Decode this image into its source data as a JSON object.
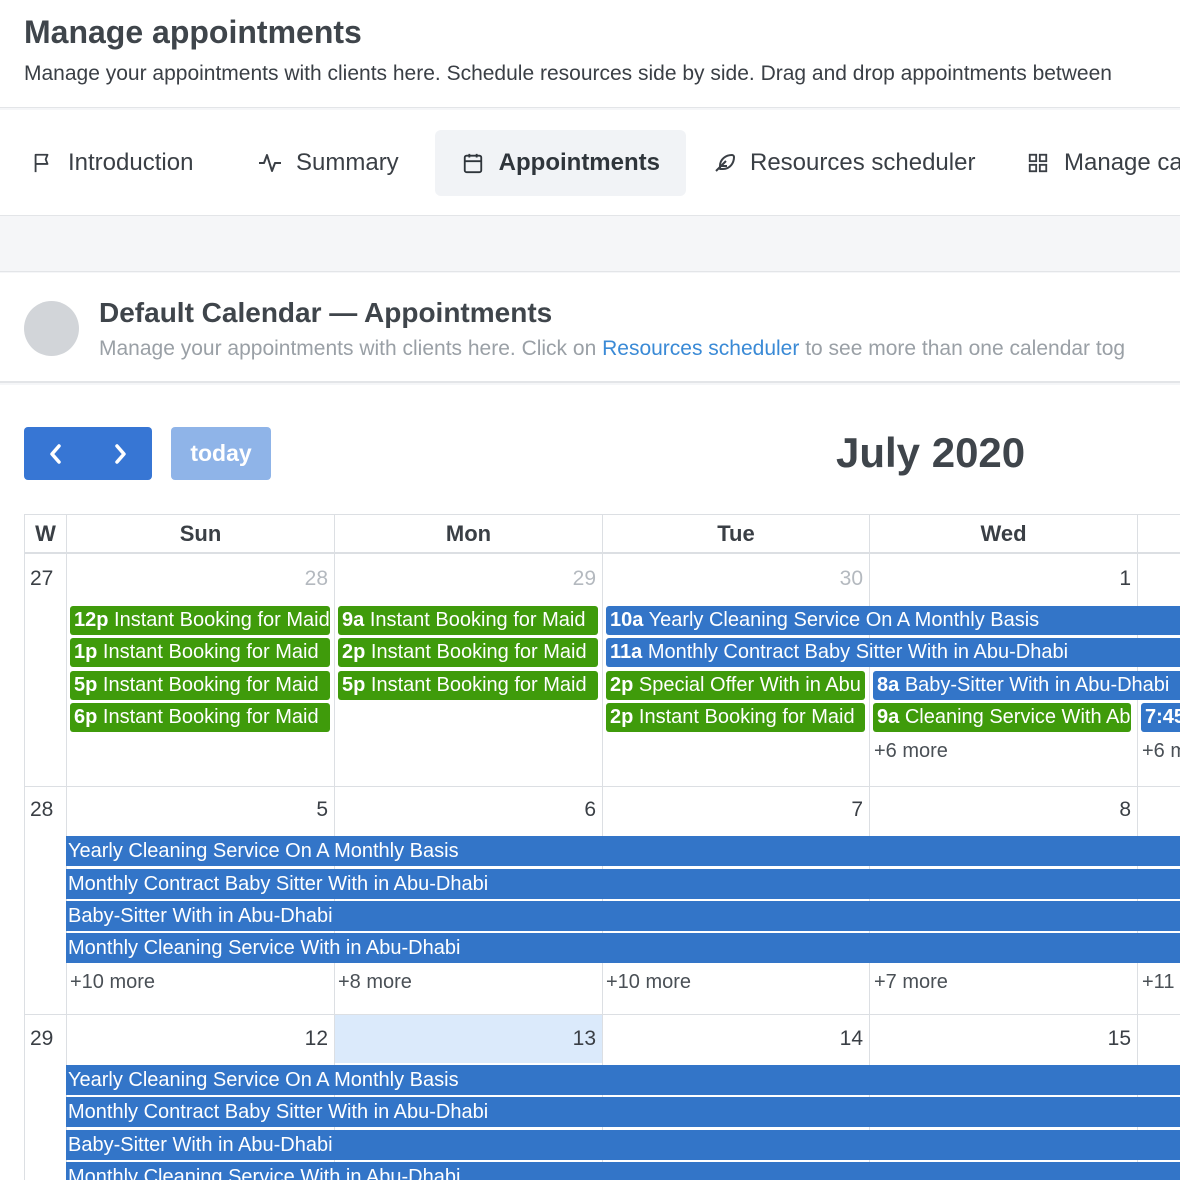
{
  "header": {
    "title": "Manage appointments",
    "subtitle": "Manage your appointments with clients here. Schedule resources side by side. Drag and drop appointments between"
  },
  "tabs": [
    {
      "label": "Introduction",
      "icon": "flag-icon"
    },
    {
      "label": "Summary",
      "icon": "activity-icon"
    },
    {
      "label": "Appointments",
      "icon": "calendar-icon",
      "active": true
    },
    {
      "label": "Resources scheduler",
      "icon": "feather-icon"
    },
    {
      "label": "Manage ca",
      "icon": "grid-icon"
    }
  ],
  "calendar_header": {
    "title": "Default Calendar — Appointments",
    "desc_before": "Manage your appointments with clients here. Click on ",
    "desc_link": "Resources scheduler",
    "desc_after": " to see more than one calendar tog"
  },
  "toolbar": {
    "today_label": "today",
    "month_title": "July 2020"
  },
  "grid": {
    "week_col_label": "W",
    "day_headers": [
      "Sun",
      "Mon",
      "Tue",
      "Wed"
    ],
    "weeks": [
      {
        "week": "27",
        "days": [
          "28",
          "29",
          "30",
          "1"
        ],
        "events": {
          "sun": [
            {
              "time": "12p",
              "title": "Instant Booking for Maid"
            },
            {
              "time": "1p",
              "title": "Instant Booking for Maid"
            },
            {
              "time": "5p",
              "title": "Instant Booking for Maid"
            },
            {
              "time": "6p",
              "title": "Instant Booking for Maid"
            }
          ],
          "mon": [
            {
              "time": "9a",
              "title": "Instant Booking for Maid"
            },
            {
              "time": "2p",
              "title": "Instant Booking for Maid"
            },
            {
              "time": "5p",
              "title": "Instant Booking for Maid"
            }
          ],
          "tue_span": [
            {
              "time": "10a",
              "title": "Yearly Cleaning Service On A Monthly Basis"
            },
            {
              "time": "11a",
              "title": "Monthly Contract Baby Sitter With in Abu-Dhabi"
            }
          ],
          "tue": [
            {
              "time": "2p",
              "title": "Special Offer With in Abu"
            },
            {
              "time": "2p",
              "title": "Instant Booking for Maid"
            }
          ],
          "wed": [
            {
              "time": "8a",
              "title": "Baby-Sitter With in Abu-Dhabi"
            },
            {
              "time": "9a",
              "title": "Cleaning Service With Ab"
            }
          ],
          "thu_partial": {
            "time": "7:45",
            "more": "+6 m"
          },
          "wed_more": "+6 more"
        }
      },
      {
        "week": "28",
        "days": [
          "5",
          "6",
          "7",
          "8"
        ],
        "bars": [
          "Yearly Cleaning Service On A Monthly Basis",
          "Monthly Contract Baby Sitter With in Abu-Dhabi",
          "Baby-Sitter With in Abu-Dhabi",
          "Monthly Cleaning Service With in Abu-Dhabi"
        ],
        "more": [
          "+10 more",
          "+8 more",
          "+10 more",
          "+7 more",
          "+11"
        ]
      },
      {
        "week": "29",
        "days": [
          "12",
          "13",
          "14",
          "15"
        ],
        "bars": [
          "Yearly Cleaning Service On A Monthly Basis",
          "Monthly Contract Baby Sitter With in Abu-Dhabi",
          "Baby-Sitter With in Abu-Dhabi",
          "Monthly Cleaning Service With in Abu-Dhabi"
        ]
      }
    ]
  },
  "colors": {
    "accent": "#3776d4",
    "event_green": "#3f9b0b",
    "event_blue": "#3375c8",
    "today_bg": "#dbeafb"
  }
}
